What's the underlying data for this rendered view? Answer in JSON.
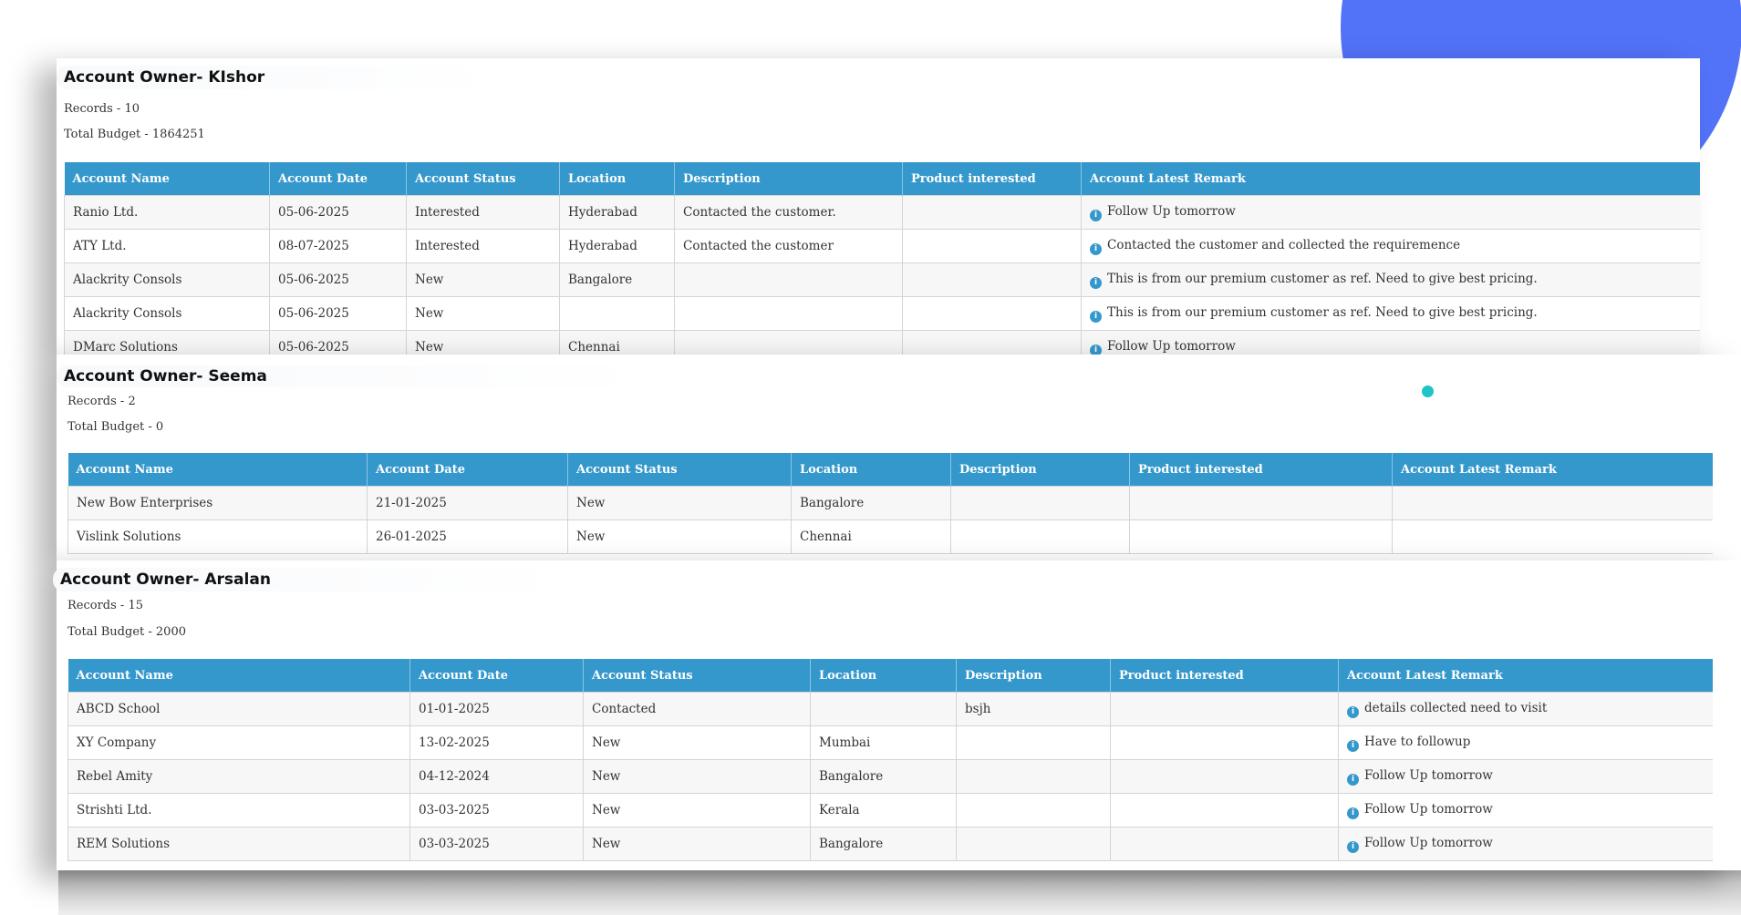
{
  "sections": [
    {
      "title": "Account Owner- KIshor",
      "records": "Records - 10",
      "budget": "Total Budget - 1864251",
      "headers": [
        "Account Name",
        "Account Date",
        "Account Status",
        "Location",
        "Description",
        "Product interested",
        "Account Latest Remark"
      ],
      "rows": [
        [
          "Ranio Ltd.",
          "05-06-2025",
          "Interested",
          "Hyderabad",
          "Contacted the customer.",
          "",
          "Follow Up tomorrow"
        ],
        [
          "ATY Ltd.",
          "08-07-2025",
          "Interested",
          "Hyderabad",
          "Contacted the customer",
          "",
          "Contacted the customer and collected the requiremence"
        ],
        [
          "Alackrity Consols",
          "05-06-2025",
          "New",
          "Bangalore",
          "",
          "",
          "This is from our premium customer as ref. Need to give best pricing."
        ],
        [
          "Alackrity Consols",
          "05-06-2025",
          "New",
          "",
          "",
          "",
          "This is from our premium customer as ref. Need to give best pricing."
        ],
        [
          "DMarc Solutions",
          "05-06-2025",
          "New",
          "Chennai",
          "",
          "",
          "Follow Up tomorrow"
        ]
      ]
    },
    {
      "title": "Account Owner- Seema",
      "records": "Records - 2",
      "budget": "Total Budget - 0",
      "headers": [
        "Account Name",
        "Account Date",
        "Account Status",
        "Location",
        "Description",
        "Product interested",
        "Account Latest Remark"
      ],
      "rows": [
        [
          "New Bow Enterprises",
          "21-01-2025",
          "New",
          "Bangalore",
          "",
          "",
          ""
        ],
        [
          "Vislink Solutions",
          "26-01-2025",
          "New",
          "Chennai",
          "",
          "",
          ""
        ]
      ]
    },
    {
      "title": "Account Owner- Arsalan",
      "records": "Records - 15",
      "budget": "Total Budget - 2000",
      "headers": [
        "Account Name",
        "Account Date",
        "Account Status",
        "Location",
        "Description",
        "Product interested",
        "Account Latest Remark"
      ],
      "rows": [
        [
          "ABCD School",
          "01-01-2025",
          "Contacted",
          "",
          "bsjh",
          "",
          "details collected need to visit"
        ],
        [
          "XY Company",
          "13-02-2025",
          "New",
          "Mumbai",
          "",
          "",
          "Have to followup"
        ],
        [
          "Rebel Amity",
          "04-12-2024",
          "New",
          "Bangalore",
          "",
          "",
          "Follow Up tomorrow"
        ],
        [
          "Strishti Ltd.",
          "03-03-2025",
          "New",
          "Kerala",
          "",
          "",
          "Follow Up tomorrow"
        ],
        [
          "REM Solutions",
          "03-03-2025",
          "New",
          "Bangalore",
          "",
          "",
          "Follow Up tomorrow"
        ]
      ]
    }
  ],
  "icons": {
    "remark": "info-icon"
  },
  "colors": {
    "header_bg": "#3598cc",
    "accent_circle": "#5272f8",
    "dot": "#1fc4c9"
  }
}
